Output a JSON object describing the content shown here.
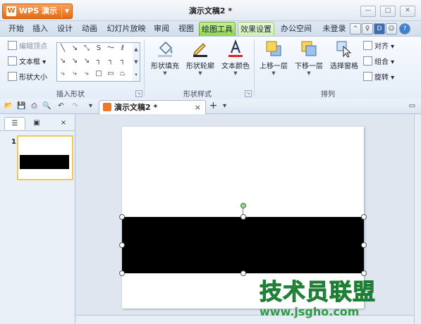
{
  "app": {
    "button_label": "WPS 演示",
    "logo_letter": "W",
    "document_title": "演示文稿2 *"
  },
  "menu": {
    "tabs": [
      "开始",
      "插入",
      "设计",
      "动画",
      "幻灯片放映",
      "审阅",
      "视图",
      "绘图工具",
      "效果设置",
      "办公空间"
    ],
    "active_tab": "绘图工具",
    "login": "未登录"
  },
  "ribbon": {
    "insert_shape": {
      "edit_points": "编辑顶点",
      "text_box": "文本框",
      "shape_size": "形状大小",
      "group_label": "插入形状"
    },
    "shape_style": {
      "fill": "形状填充",
      "outline": "形状轮廓",
      "text_color": "文本颜色",
      "group_label": "形状样式"
    },
    "arrange": {
      "bring_forward": "上移一层",
      "send_backward": "下移一层",
      "selection_pane": "选择窗格",
      "align": "对齐",
      "group": "组合",
      "rotate": "旋转",
      "group_label": "排列"
    }
  },
  "document_tab": {
    "label": "演示文稿2 *",
    "close": "×",
    "add": "+"
  },
  "left_pane": {
    "slide_number": "1",
    "close": "×"
  },
  "watermark": {
    "site_name": "技术员联盟",
    "url": "www.jsgho.com"
  },
  "colors": {
    "active_tab": "#8fd64a",
    "wps_button": "#e56a13",
    "shape_fill": "#000000",
    "watermark": "#35a54a"
  }
}
